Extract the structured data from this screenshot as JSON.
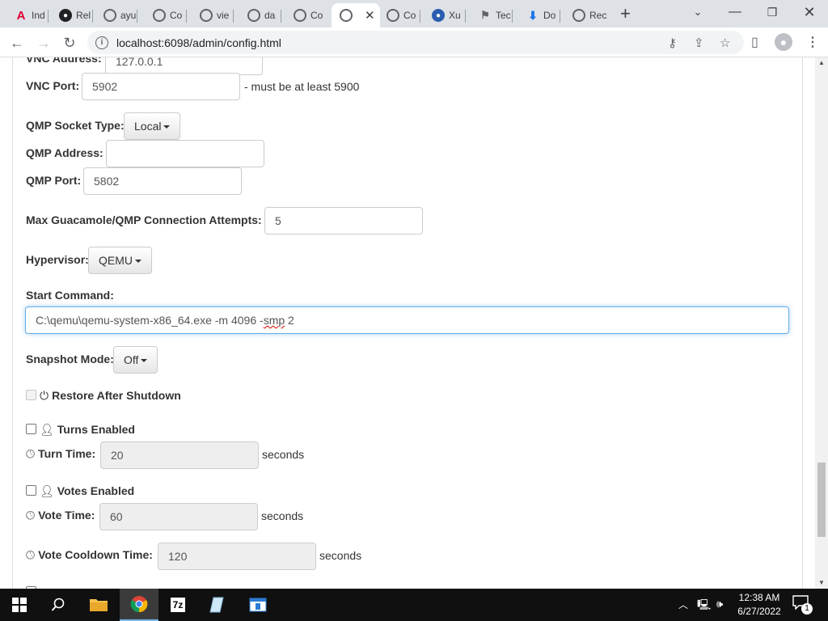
{
  "browser": {
    "tabs": [
      {
        "title": "Ind",
        "icon": "angular-icon",
        "color": "#dd0031"
      },
      {
        "title": "Rel",
        "icon": "github-icon",
        "color": "#202124"
      },
      {
        "title": "ayu",
        "icon": "globe-icon",
        "color": "#5f6368"
      },
      {
        "title": "Co",
        "icon": "globe-icon",
        "color": "#5f6368"
      },
      {
        "title": "vie",
        "icon": "globe-icon",
        "color": "#5f6368"
      },
      {
        "title": "da",
        "icon": "globe-icon",
        "color": "#5f6368"
      },
      {
        "title": "Co",
        "icon": "globe-icon",
        "color": "#5f6368"
      },
      {
        "title": "",
        "icon": "globe-icon",
        "color": "#5f6368",
        "active": true
      },
      {
        "title": "Co",
        "icon": "globe-icon",
        "color": "#5f6368"
      },
      {
        "title": "Xu",
        "icon": "xubuntu-icon",
        "color": "#2a5db0"
      },
      {
        "title": "Tec",
        "icon": "windows-flag-icon",
        "color": "#5f6368"
      },
      {
        "title": "Do",
        "icon": "download-icon",
        "color": "#1a73e8"
      },
      {
        "title": "Rec",
        "icon": "globe-icon",
        "color": "#5f6368"
      }
    ],
    "url": "localhost:6098/admin/config.html"
  },
  "form": {
    "vnc_address_label": "VNC Address:",
    "vnc_address_value": "127.0.0.1",
    "vnc_port_label": "VNC Port:",
    "vnc_port_value": "5902",
    "vnc_port_note": "- must be at least 5900",
    "qmp_socket_type_label": "QMP Socket Type:",
    "qmp_socket_type_value": "Local",
    "qmp_address_label": "QMP Address:",
    "qmp_address_value": "",
    "qmp_port_label": "QMP Port:",
    "qmp_port_value": "5802",
    "max_attempts_label": "Max Guacamole/QMP Connection Attempts:",
    "max_attempts_value": "5",
    "hypervisor_label": "Hypervisor:",
    "hypervisor_value": "QEMU",
    "start_command_label": "Start Command:",
    "start_command_value_prefix": "C:\\qemu\\qemu-system-x86_64.exe -m 4096 -",
    "start_command_value_squiggle": "smp",
    "start_command_value_suffix": " 2",
    "snapshot_mode_label": "Snapshot Mode:",
    "snapshot_mode_value": "Off",
    "restore_after_shutdown_label": "Restore After Shutdown",
    "turns_enabled_label": "Turns Enabled",
    "turn_time_label": "Turn Time:",
    "turn_time_value": "20",
    "turn_time_unit": "seconds",
    "votes_enabled_label": "Votes Enabled",
    "vote_time_label": "Vote Time:",
    "vote_time_value": "60",
    "vote_time_unit": "seconds",
    "vote_cooldown_label": "Vote Cooldown Time:",
    "vote_cooldown_value": "120",
    "vote_cooldown_unit": "seconds"
  },
  "taskbar": {
    "time": "12:38 AM",
    "date": "6/27/2022",
    "notification_count": "1"
  }
}
